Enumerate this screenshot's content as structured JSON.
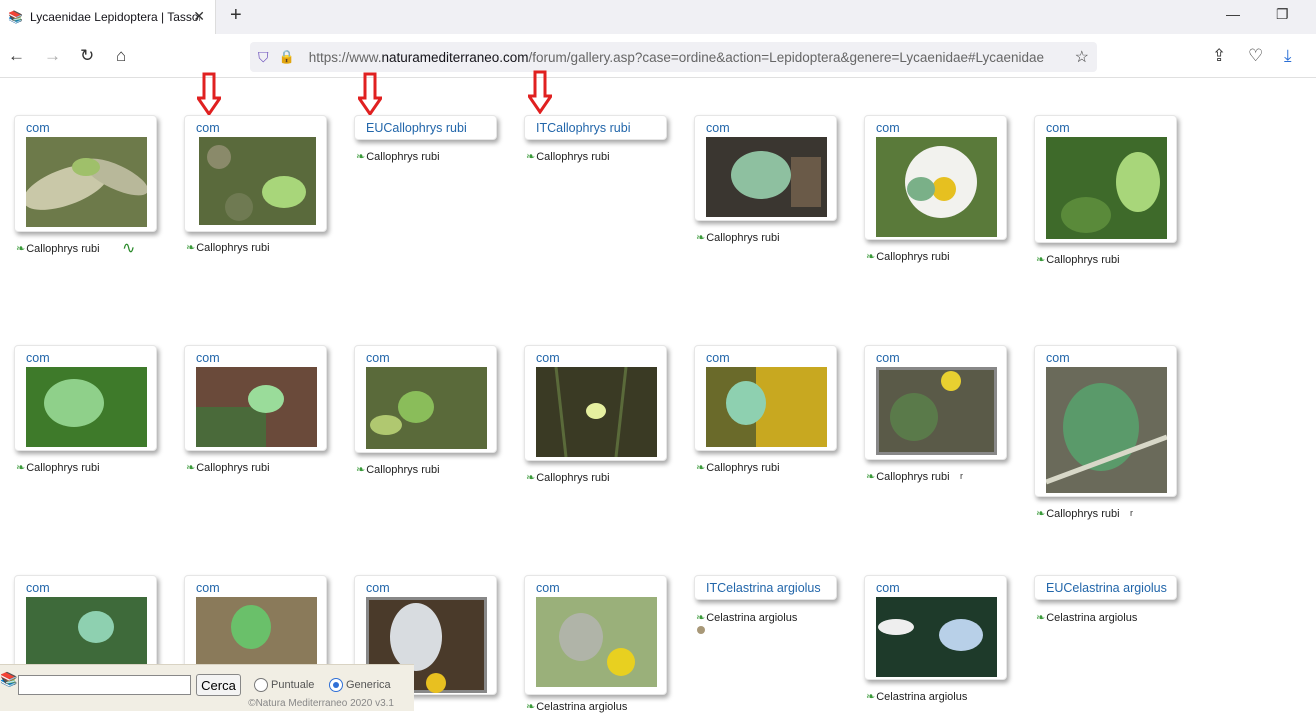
{
  "browser": {
    "tab_title": "Lycaenidae Lepidoptera | Tassonomia",
    "url_prefix": "https://www.",
    "url_domain": "naturamediterraneo.com",
    "url_rest": "/forum/gallery.asp?case=ordine&action=Lepidoptera&genere=Lycaenidae#Lycaenidae"
  },
  "gallery": {
    "row1": [
      {
        "label": "com",
        "caption": "Callophrys rubi",
        "extra": "∿"
      },
      {
        "label": "com",
        "caption": "Callophrys rubi"
      },
      {
        "label": "EUCallophrys rubi",
        "caption": "Callophrys rubi"
      },
      {
        "label": "ITCallophrys rubi",
        "caption": "Callophrys rubi"
      },
      {
        "label": "com",
        "caption": "Callophrys rubi"
      },
      {
        "label": "com",
        "caption": "Callophrys rubi"
      },
      {
        "label": "com",
        "caption": "Callophrys rubi"
      }
    ],
    "row2": [
      {
        "label": "com",
        "caption": "Callophrys rubi"
      },
      {
        "label": "com",
        "caption": "Callophrys rubi"
      },
      {
        "label": "com",
        "caption": "Callophrys rubi"
      },
      {
        "label": "com",
        "caption": "Callophrys rubi"
      },
      {
        "label": "com",
        "caption": "Callophrys rubi"
      },
      {
        "label": "com",
        "caption": "Callophrys rubi",
        "extra": "r"
      },
      {
        "label": "com",
        "caption": "Callophrys rubi",
        "extra": "r"
      }
    ],
    "row3": [
      {
        "label": "com"
      },
      {
        "label": "com"
      },
      {
        "label": "com"
      },
      {
        "label": "com",
        "caption": "Celastrina argiolus"
      },
      {
        "label": "ITCelastrina argiolus",
        "caption": "Celastrina argiolus"
      },
      {
        "label": "com",
        "caption": "Celastrina argiolus"
      },
      {
        "label": "EUCelastrina argiolus",
        "caption": "Celastrina argiolus"
      }
    ]
  },
  "search": {
    "button": "Cerca",
    "opt_puntuale": "Puntuale",
    "opt_generica": "Generica",
    "copyright": "©Natura Mediterraneo 2020 v3.1"
  },
  "colors": {
    "link": "#2266aa",
    "arrow": "#e02020",
    "leaf": "#3a9a3a"
  }
}
